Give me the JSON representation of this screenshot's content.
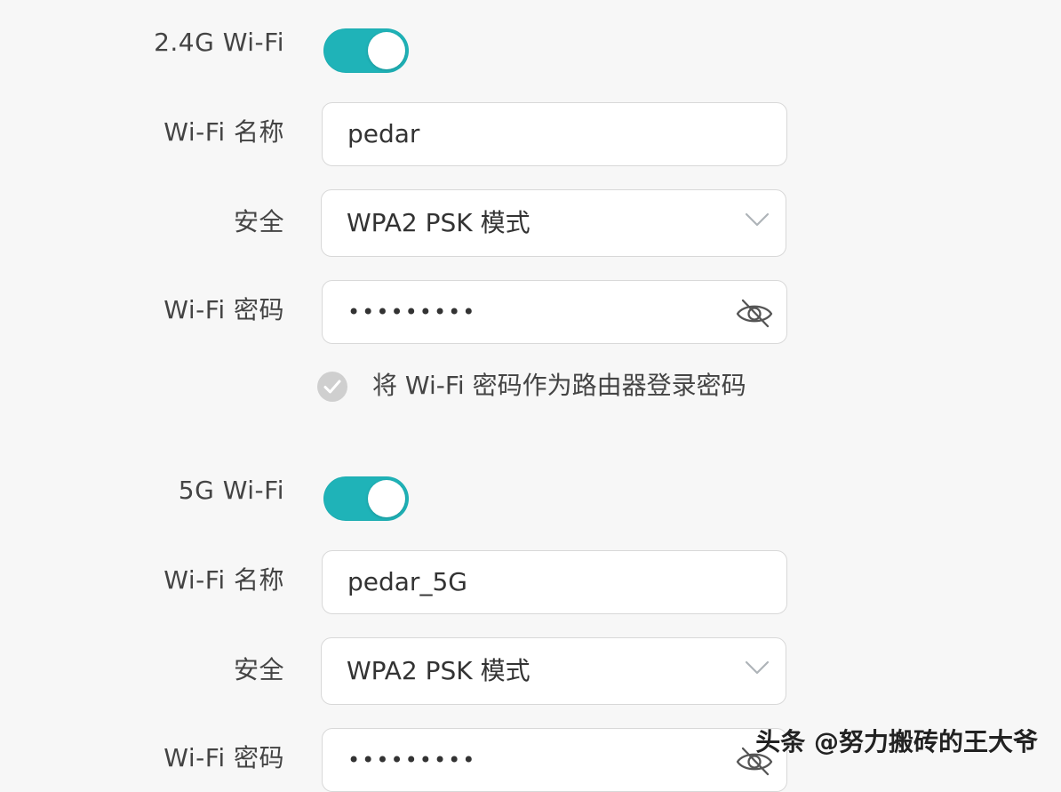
{
  "section_24g": {
    "toggle_label": "2.4G Wi-Fi",
    "toggle_state": "on",
    "name_label": "Wi-Fi 名称",
    "name_value": "pedar",
    "security_label": "安全",
    "security_value": "WPA2 PSK 模式",
    "password_label": "Wi-Fi 密码",
    "password_value": "•••••••••",
    "checkbox_label": "将 Wi-Fi 密码作为路由器登录密码"
  },
  "section_5g": {
    "toggle_label": "5G Wi-Fi",
    "toggle_state": "on",
    "name_label": "Wi-Fi 名称",
    "name_value": "pedar_5G",
    "security_label": "安全",
    "security_value": "WPA2 PSK 模式",
    "password_label": "Wi-Fi 密码",
    "password_value": "•••••••••"
  },
  "watermark": "头条 @努力搬砖的王大爷",
  "colors": {
    "toggle_on": "#1fb3b8",
    "background": "#f7f7f7",
    "field_border": "#d8d8d8",
    "checkbox": "#cfcfcf"
  },
  "icons": {
    "chevron": "chevron-down-icon",
    "eye": "eye-off-icon",
    "check": "check-icon"
  }
}
